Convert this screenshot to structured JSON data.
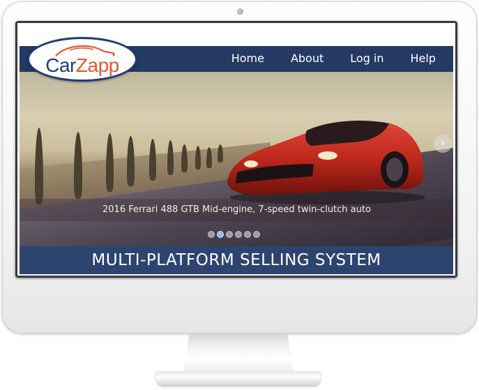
{
  "brand": {
    "logo_prefix": "Car",
    "logo_suffix": "Zapp"
  },
  "nav": {
    "items": [
      "Home",
      "About",
      "Log in",
      "Help"
    ]
  },
  "hero": {
    "caption": "2016 Ferrari 488 GTB Mid-engine, 7-speed twin-clutch auto",
    "next_arrow": "›",
    "slide_count": 6,
    "active_slide": 2
  },
  "banner": {
    "title": "MULTI-PLATFORM SELLING SYSTEM"
  },
  "colors": {
    "nav_bg": "#243a63",
    "banner_bg": "#2d4470",
    "logo_blue": "#1f3b78",
    "logo_orange": "#e8572a",
    "car_red": "#c0281c"
  }
}
